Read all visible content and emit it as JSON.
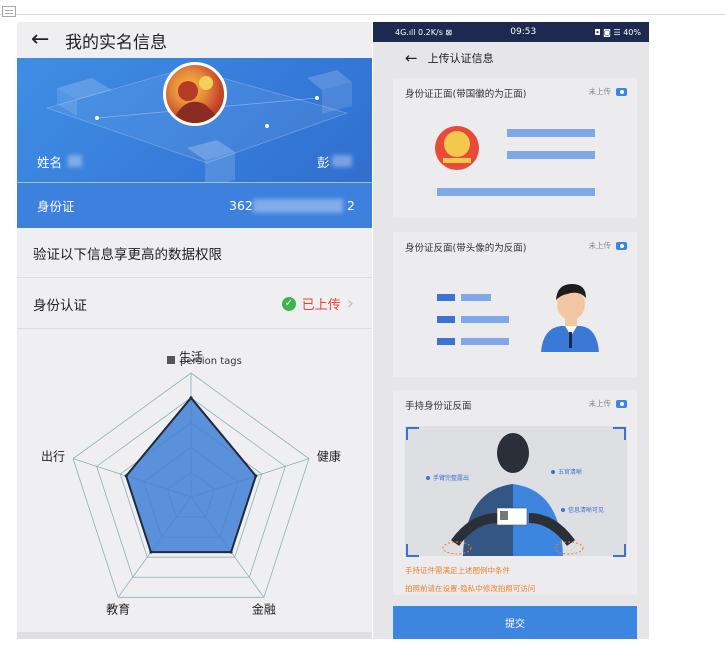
{
  "left": {
    "title": "我的实名信息",
    "name_label": "姓名",
    "name_value": "彭",
    "id_label": "身份证",
    "id_prefix": "362",
    "id_suffix": "2",
    "verify_hint": "验证以下信息享更高的数据权限",
    "id_auth_label": "身份认证",
    "id_auth_status": "已上传",
    "chart_legend": "persion tags"
  },
  "chart_data": {
    "type": "radar",
    "categories": [
      "生活",
      "健康",
      "金融",
      "教育",
      "出行"
    ],
    "series": [
      {
        "name": "persion tags",
        "values": [
          80,
          55,
          55,
          55,
          55
        ]
      }
    ],
    "ylim": [
      0,
      100
    ],
    "legend": "top",
    "color": "#3f80d6"
  },
  "right": {
    "status_bar": {
      "signal": "4G.ıll 0.2K/s ⊠",
      "time": "09:53",
      "right": "◘ ◙ ☰ 40%"
    },
    "title": "上传认证信息",
    "front_title": "身份证正面(带国徽的为正面)",
    "front_status": "未上传",
    "back_title": "身份证反面(带头像的为反面)",
    "back_status": "未上传",
    "hold_title": "手持身份证反面",
    "hold_status": "未上传",
    "hold_labels": {
      "a": "手臂完整露出",
      "b": "五官清晰",
      "c": "信息清晰可见"
    },
    "note1": "手持证件需满足上述图例中条件",
    "note2": "拍照前请在设置-隐私中修改拍照可访问",
    "submit": "提交"
  }
}
